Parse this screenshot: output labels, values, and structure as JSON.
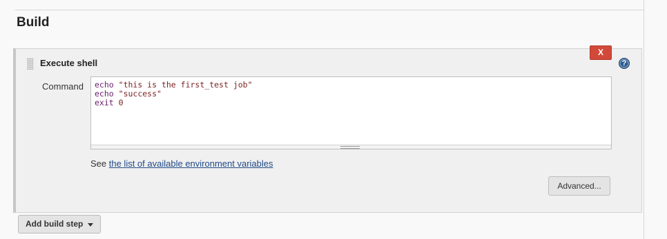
{
  "section": {
    "title": "Build"
  },
  "step": {
    "title": "Execute shell",
    "delete_label": "X",
    "help_symbol": "?",
    "command_label": "Command",
    "command_lines": [
      {
        "kw": "echo",
        "arg": "\"this is the first_test job\""
      },
      {
        "kw": "echo",
        "arg": "\"success\""
      },
      {
        "kw": "exit",
        "arg": "0"
      }
    ],
    "see_prefix": "See ",
    "env_link": "the list of available environment variables",
    "advanced_label": "Advanced..."
  },
  "add_step": {
    "label": "Add build step"
  },
  "colors": {
    "delete": "#d24939",
    "link": "#204a87",
    "keyword": "#6a1b6a",
    "string": "#7a1f1f",
    "help": "#2d5a8c"
  }
}
